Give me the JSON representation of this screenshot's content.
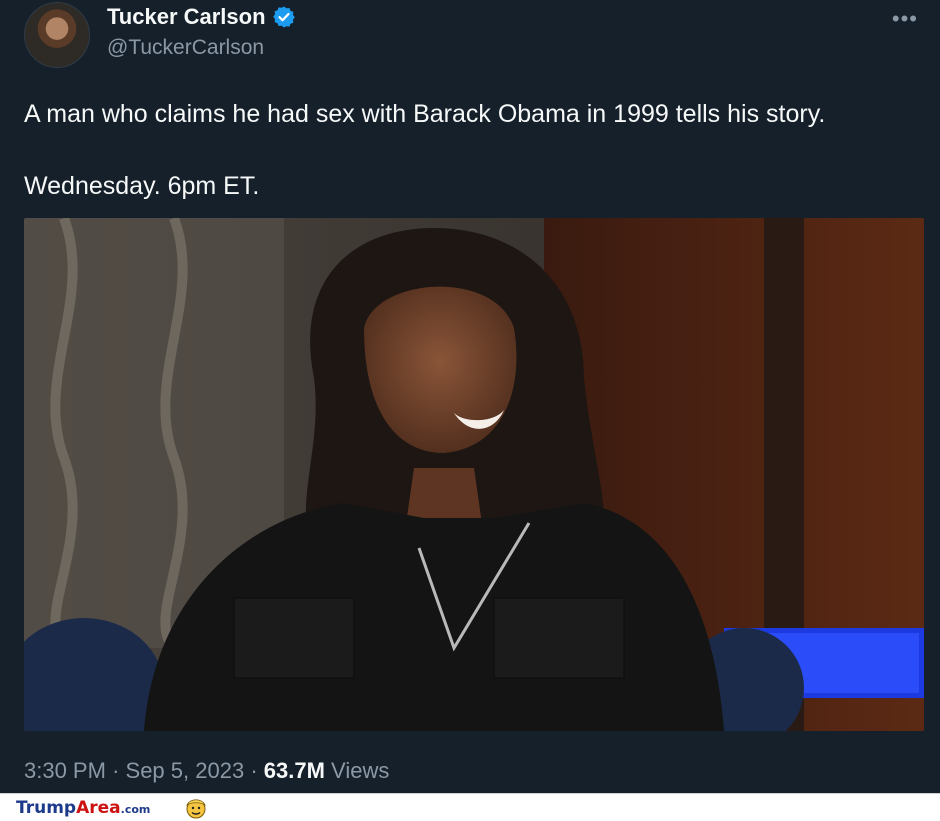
{
  "tweet": {
    "display_name": "Tucker Carlson",
    "handle": "@TuckerCarlson",
    "more_label": "•••",
    "text_line1": "A man who claims he had sex with Barack Obama in 1999 tells his story.",
    "text_line2": "Wednesday. 6pm ET.",
    "time": "3:30 PM",
    "separator": "·",
    "date": "Sep 5, 2023",
    "views_count": "63.7M",
    "views_label": "Views"
  },
  "icons": {
    "verified": "verified-badge-icon",
    "more": "more-options-icon",
    "brand": "trump-emoji-icon"
  },
  "footer": {
    "brand_part1": "Trump",
    "brand_part2": "Area",
    "brand_part3": ".com"
  },
  "colors": {
    "background": "#15202b",
    "primary_text": "#f7f9f9",
    "secondary_text": "#8b98a5",
    "verified_blue": "#1d9bf0"
  }
}
